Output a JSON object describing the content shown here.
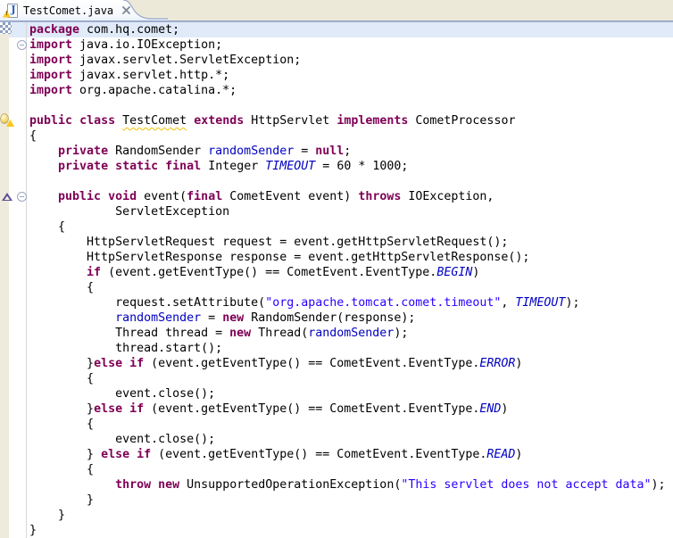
{
  "tab": {
    "title": "TestComet.java",
    "icon": "java-file-warning-icon",
    "close_icon": "close-icon"
  },
  "colors": {
    "tabbar_bg": "#ECE9D8",
    "divider_top": "#8596BE",
    "current_line_highlight": "#E0EAF8",
    "annotation_ruler_bg": "#EEEBDC",
    "keyword": "#7F0055",
    "string": "#2A00FF",
    "field": "#0000C0",
    "warning_underline": "#EDC000"
  },
  "editor": {
    "language": "java",
    "current_line": 1,
    "lines": [
      {
        "tokens": [
          [
            "k",
            "package"
          ],
          [
            "p",
            " com.hq.comet;"
          ]
        ]
      },
      {
        "tokens": [
          [
            "k",
            "import"
          ],
          [
            "p",
            " java.io.IOException;"
          ]
        ],
        "markers": [
          "fold"
        ]
      },
      {
        "tokens": [
          [
            "k",
            "import"
          ],
          [
            "p",
            " javax.servlet.ServletException;"
          ]
        ]
      },
      {
        "tokens": [
          [
            "k",
            "import"
          ],
          [
            "p",
            " javax.servlet.http.*;"
          ]
        ]
      },
      {
        "tokens": [
          [
            "k",
            "import"
          ],
          [
            "p",
            " org.apache.catalina.*;"
          ]
        ]
      },
      {
        "tokens": []
      },
      {
        "tokens": [
          [
            "k",
            "public"
          ],
          [
            "p",
            " "
          ],
          [
            "k",
            "class"
          ],
          [
            "p",
            " "
          ],
          [
            "w",
            "TestComet"
          ],
          [
            "p",
            " "
          ],
          [
            "k",
            "extends"
          ],
          [
            "p",
            " HttpServlet "
          ],
          [
            "k",
            "implements"
          ],
          [
            "p",
            " CometProcessor"
          ]
        ],
        "markers": [
          "warning"
        ]
      },
      {
        "tokens": [
          [
            "p",
            "{"
          ]
        ]
      },
      {
        "tokens": [
          [
            "p",
            "    "
          ],
          [
            "k",
            "private"
          ],
          [
            "p",
            " RandomSender "
          ],
          [
            "f",
            "randomSender"
          ],
          [
            "p",
            " = "
          ],
          [
            "k",
            "null"
          ],
          [
            "p",
            ";"
          ]
        ]
      },
      {
        "tokens": [
          [
            "p",
            "    "
          ],
          [
            "k",
            "private"
          ],
          [
            "p",
            " "
          ],
          [
            "k",
            "static"
          ],
          [
            "p",
            " "
          ],
          [
            "k",
            "final"
          ],
          [
            "p",
            " Integer "
          ],
          [
            "sf",
            "TIMEOUT"
          ],
          [
            "p",
            " = 60 * 1000;"
          ]
        ]
      },
      {
        "tokens": []
      },
      {
        "tokens": [
          [
            "p",
            "    "
          ],
          [
            "k",
            "public"
          ],
          [
            "p",
            " "
          ],
          [
            "k",
            "void"
          ],
          [
            "p",
            " event("
          ],
          [
            "k",
            "final"
          ],
          [
            "p",
            " CometEvent event) "
          ],
          [
            "k",
            "throws"
          ],
          [
            "p",
            " IOException,"
          ]
        ],
        "markers": [
          "override",
          "fold"
        ]
      },
      {
        "tokens": [
          [
            "p",
            "            ServletException"
          ]
        ]
      },
      {
        "tokens": [
          [
            "p",
            "    {"
          ]
        ]
      },
      {
        "tokens": [
          [
            "p",
            "        HttpServletRequest request = event.getHttpServletRequest();"
          ]
        ]
      },
      {
        "tokens": [
          [
            "p",
            "        HttpServletResponse response = event.getHttpServletResponse();"
          ]
        ]
      },
      {
        "tokens": [
          [
            "p",
            "        "
          ],
          [
            "k",
            "if"
          ],
          [
            "p",
            " (event.getEventType() == CometEvent.EventType."
          ],
          [
            "sf",
            "BEGIN"
          ],
          [
            "p",
            ")"
          ]
        ]
      },
      {
        "tokens": [
          [
            "p",
            "        {"
          ]
        ]
      },
      {
        "tokens": [
          [
            "p",
            "            request.setAttribute("
          ],
          [
            "s",
            "\"org.apache.tomcat.comet.timeout\""
          ],
          [
            "p",
            ", "
          ],
          [
            "sf",
            "TIMEOUT"
          ],
          [
            "p",
            ");"
          ]
        ]
      },
      {
        "tokens": [
          [
            "p",
            "            "
          ],
          [
            "f",
            "randomSender"
          ],
          [
            "p",
            " = "
          ],
          [
            "k",
            "new"
          ],
          [
            "p",
            " RandomSender(response);"
          ]
        ]
      },
      {
        "tokens": [
          [
            "p",
            "            Thread thread = "
          ],
          [
            "k",
            "new"
          ],
          [
            "p",
            " Thread("
          ],
          [
            "f",
            "randomSender"
          ],
          [
            "p",
            ");"
          ]
        ]
      },
      {
        "tokens": [
          [
            "p",
            "            thread.start();"
          ]
        ]
      },
      {
        "tokens": [
          [
            "p",
            "        }"
          ],
          [
            "k",
            "else"
          ],
          [
            "p",
            " "
          ],
          [
            "k",
            "if"
          ],
          [
            "p",
            " (event.getEventType() == CometEvent.EventType."
          ],
          [
            "sf",
            "ERROR"
          ],
          [
            "p",
            ")"
          ]
        ]
      },
      {
        "tokens": [
          [
            "p",
            "        {"
          ]
        ]
      },
      {
        "tokens": [
          [
            "p",
            "            event.close();"
          ]
        ]
      },
      {
        "tokens": [
          [
            "p",
            "        }"
          ],
          [
            "k",
            "else"
          ],
          [
            "p",
            " "
          ],
          [
            "k",
            "if"
          ],
          [
            "p",
            " (event.getEventType() == CometEvent.EventType."
          ],
          [
            "sf",
            "END"
          ],
          [
            "p",
            ")"
          ]
        ]
      },
      {
        "tokens": [
          [
            "p",
            "        {"
          ]
        ]
      },
      {
        "tokens": [
          [
            "p",
            "            event.close();"
          ]
        ]
      },
      {
        "tokens": [
          [
            "p",
            "        } "
          ],
          [
            "k",
            "else"
          ],
          [
            "p",
            " "
          ],
          [
            "k",
            "if"
          ],
          [
            "p",
            " (event.getEventType() == CometEvent.EventType."
          ],
          [
            "sf",
            "READ"
          ],
          [
            "p",
            ")"
          ]
        ]
      },
      {
        "tokens": [
          [
            "p",
            "        {"
          ]
        ]
      },
      {
        "tokens": [
          [
            "p",
            "            "
          ],
          [
            "k",
            "throw"
          ],
          [
            "p",
            " "
          ],
          [
            "k",
            "new"
          ],
          [
            "p",
            " UnsupportedOperationException("
          ],
          [
            "s",
            "\"This servlet does not accept data\""
          ],
          [
            "p",
            ");"
          ]
        ]
      },
      {
        "tokens": [
          [
            "p",
            "        }"
          ]
        ]
      },
      {
        "tokens": [
          [
            "p",
            "    }"
          ]
        ]
      },
      {
        "tokens": [
          [
            "p",
            "}"
          ]
        ]
      }
    ]
  }
}
